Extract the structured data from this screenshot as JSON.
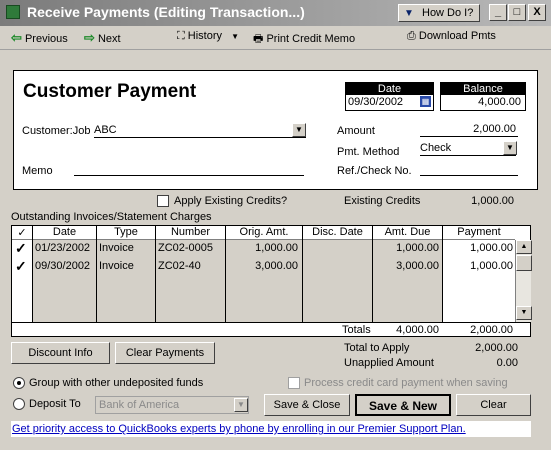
{
  "window": {
    "title": "Receive Payments (Editing Transaction...)",
    "how_do_i": "How Do I?",
    "minimize": "_",
    "maximize": "□",
    "close": "X"
  },
  "toolbar": {
    "previous": "Previous",
    "next": "Next",
    "history": "History",
    "print_credit_memo": "Print Credit Memo",
    "download_pmts": "Download Pmts"
  },
  "form": {
    "heading": "Customer Payment",
    "date_label": "Date",
    "date_value": "09/30/2002",
    "balance_label": "Balance",
    "balance_value": "4,000.00",
    "customer_job_label": "Customer:Job",
    "customer_job_value": "ABC",
    "amount_label": "Amount",
    "amount_value": "2,000.00",
    "pmt_method_label": "Pmt. Method",
    "pmt_method_value": "Check",
    "memo_label": "Memo",
    "memo_value": "",
    "ref_check_label": "Ref./Check No.",
    "ref_check_value": ""
  },
  "credits": {
    "apply_label": "Apply Existing Credits?",
    "existing_label": "Existing Credits",
    "existing_value": "1,000.00"
  },
  "table": {
    "section_title": "Outstanding Invoices/Statement Charges",
    "check_header": "✓",
    "columns": [
      "Date",
      "Type",
      "Number",
      "Orig. Amt.",
      "Disc. Date",
      "Amt. Due",
      "Payment"
    ],
    "rows": [
      {
        "checked": "✓",
        "date": "01/23/2002",
        "type": "Invoice",
        "number": "ZC02-0005",
        "orig": "1,000.00",
        "disc": "",
        "due": "1,000.00",
        "payment": "1,000.00"
      },
      {
        "checked": "✓",
        "date": "09/30/2002",
        "type": "Invoice",
        "number": "ZC02-40",
        "orig": "3,000.00",
        "disc": "",
        "due": "3,000.00",
        "payment": "1,000.00"
      }
    ],
    "totals_label": "Totals",
    "totals_due": "4,000.00",
    "totals_payment": "2,000.00"
  },
  "summary": {
    "discount_info": "Discount Info",
    "clear_payments": "Clear Payments",
    "total_to_apply_label": "Total to Apply",
    "total_to_apply_value": "2,000.00",
    "unapplied_label": "Unapplied Amount",
    "unapplied_value": "0.00"
  },
  "deposit": {
    "group_label": "Group with other undeposited funds",
    "deposit_to_label": "Deposit To",
    "deposit_to_value": "Bank of America",
    "process_cc_label": "Process credit card payment when saving"
  },
  "buttons": {
    "save_close": "Save & Close",
    "save_new": "Save & New",
    "clear": "Clear"
  },
  "footer": {
    "link": "Get priority access to QuickBooks experts by phone by enrolling in our Premier Support Plan."
  }
}
